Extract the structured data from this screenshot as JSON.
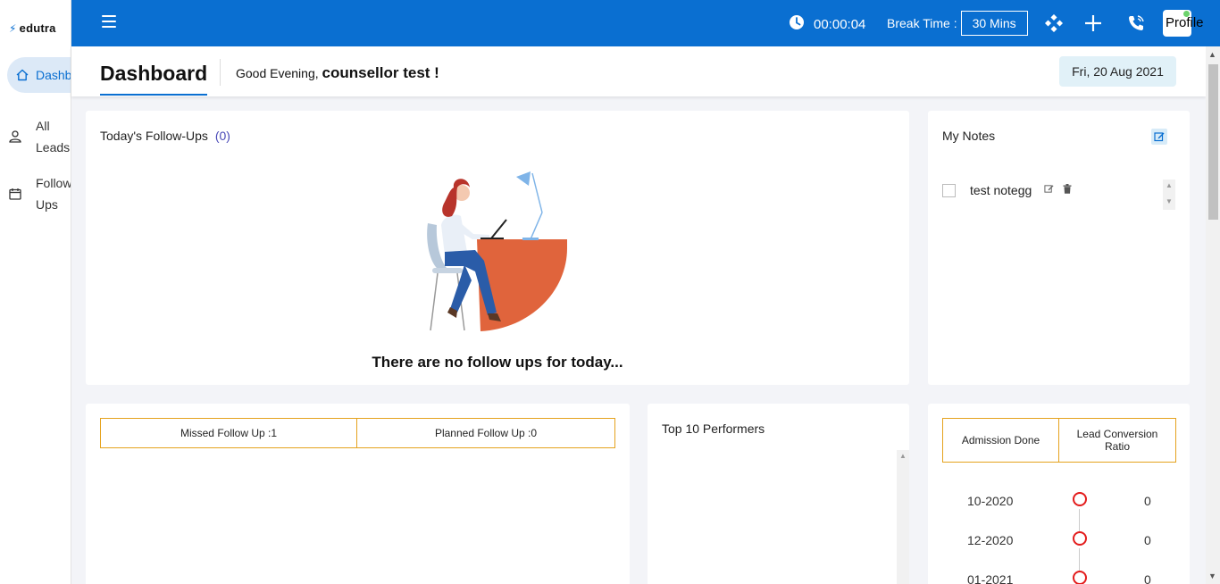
{
  "app": {
    "logo_text": "edutra"
  },
  "sidebar": {
    "items": [
      {
        "label": "Dashb",
        "icon": "home-icon",
        "active": true
      },
      {
        "label_line1": "All",
        "label_line2": "Leads",
        "icon": "users-icon"
      },
      {
        "label_line1": "Follow",
        "label_line2": "Ups",
        "icon": "calendar-icon"
      }
    ]
  },
  "topbar": {
    "timer": "00:00:04",
    "break_label": "Break Time :",
    "break_value": "30 Mins",
    "profile_label": "Profile"
  },
  "header": {
    "title": "Dashboard",
    "greeting": "Good Evening,",
    "user_name": "counsellor test !",
    "date": "Fri, 20 Aug 2021"
  },
  "followups": {
    "title": "Today's Follow-Ups",
    "count": "(0)",
    "empty_message": "There are no follow ups for today..."
  },
  "notes": {
    "title": "My Notes",
    "items": [
      {
        "text": "test notegg",
        "checked": false
      }
    ]
  },
  "followup_tabs": [
    {
      "label": "Missed Follow Up :1"
    },
    {
      "label": "Planned Follow Up :0"
    }
  ],
  "performers": {
    "title": "Top 10 Performers"
  },
  "admission": {
    "tabs": [
      {
        "label": "Admission Done"
      },
      {
        "label": "Lead Conversion Ratio"
      }
    ],
    "rows": [
      {
        "month": "10-2020",
        "value": "0"
      },
      {
        "month": "12-2020",
        "value": "0"
      },
      {
        "month": "01-2021",
        "value": "0"
      }
    ]
  },
  "colors": {
    "primary": "#0a6fd1",
    "tab_border": "#e5a21d",
    "timeline_circle": "#e31b1b",
    "illustration_desk": "#e0643c"
  }
}
